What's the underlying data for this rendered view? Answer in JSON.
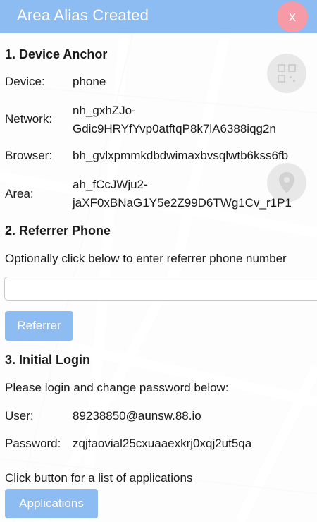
{
  "header": {
    "title": "Area Alias Created",
    "close_label": "x"
  },
  "device_anchor": {
    "heading": "1. Device Anchor",
    "rows": [
      {
        "label": "Device:",
        "value": "phone"
      },
      {
        "label": "Network:",
        "value_line1": "nh_gxhZJo-",
        "value_line2": "Gdic9HRYfYvp0atftqP8k7lA6388iqg2n"
      },
      {
        "label": "Browser:",
        "value": "bh_gvlxpmmkdbdwimaxbvsqlwtb6kss6fb"
      },
      {
        "label": "Area:",
        "value_line1": "ah_fCcJWju2-",
        "value_line2": "jaXF0xBNaG1Y5e2Z99D6TWg1Cv_r1P1"
      }
    ]
  },
  "referrer": {
    "heading": "2. Referrer Phone",
    "instruction": "Optionally click below to enter referrer phone number",
    "input_value": "",
    "button_label": "Referrer"
  },
  "login": {
    "heading": "3. Initial Login",
    "instruction": "Please login and change password below:",
    "user_label": "User:",
    "user_value": "89238850@aunsw.88.io",
    "password_label": "Password:",
    "password_value": "zqjtaovial25cxuaaexkrj0xqj2ut5qa",
    "apps_instruction": "Click button for a list of applications",
    "apps_button_label": "Applications"
  },
  "icons": [
    "qr-code-icon",
    "map-pin-icon"
  ],
  "colors": {
    "header": "#8cbcf2",
    "close": "#f59aa6",
    "button": "#8cbcf2"
  }
}
